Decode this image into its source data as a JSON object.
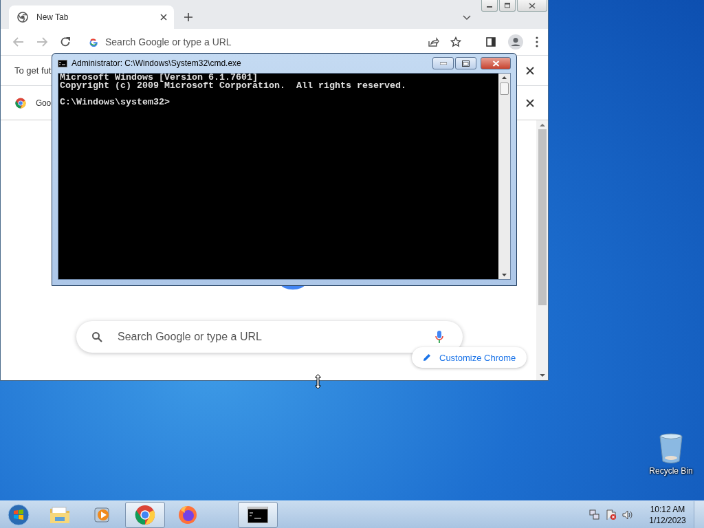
{
  "browser": {
    "tabs": [
      {
        "title": "New Tab",
        "selected": true
      }
    ],
    "omnibox": {
      "placeholder": "Search Google or type a URL"
    },
    "infobars": [
      {
        "kind": "text",
        "text": "To get fut"
      },
      {
        "kind": "app",
        "text": "Goo"
      }
    ],
    "search": {
      "placeholder": "Search Google or type a URL"
    },
    "customize_button": "Customize Chrome"
  },
  "console": {
    "title": "Administrator: C:\\Windows\\System32\\cmd.exe",
    "header_lines": [
      "Microsoft Windows [Version 6.1.7601]",
      "Copyright (c) 2009 Microsoft Corporation.  All rights reserved."
    ],
    "prompt": "C:\\Windows\\system32>"
  },
  "desktop_icons": [
    {
      "label": "Recycle Bin"
    }
  ],
  "taskbar": {
    "buttons": [
      {
        "kind": "explorer",
        "selected": false
      },
      {
        "kind": "media",
        "selected": false
      },
      {
        "kind": "chrome",
        "selected": true
      },
      {
        "kind": "firefox",
        "selected": false
      },
      {
        "kind": "cmd",
        "selected": true
      }
    ],
    "clock": {
      "time": "10:12 AM",
      "date": "1/12/2023"
    }
  }
}
